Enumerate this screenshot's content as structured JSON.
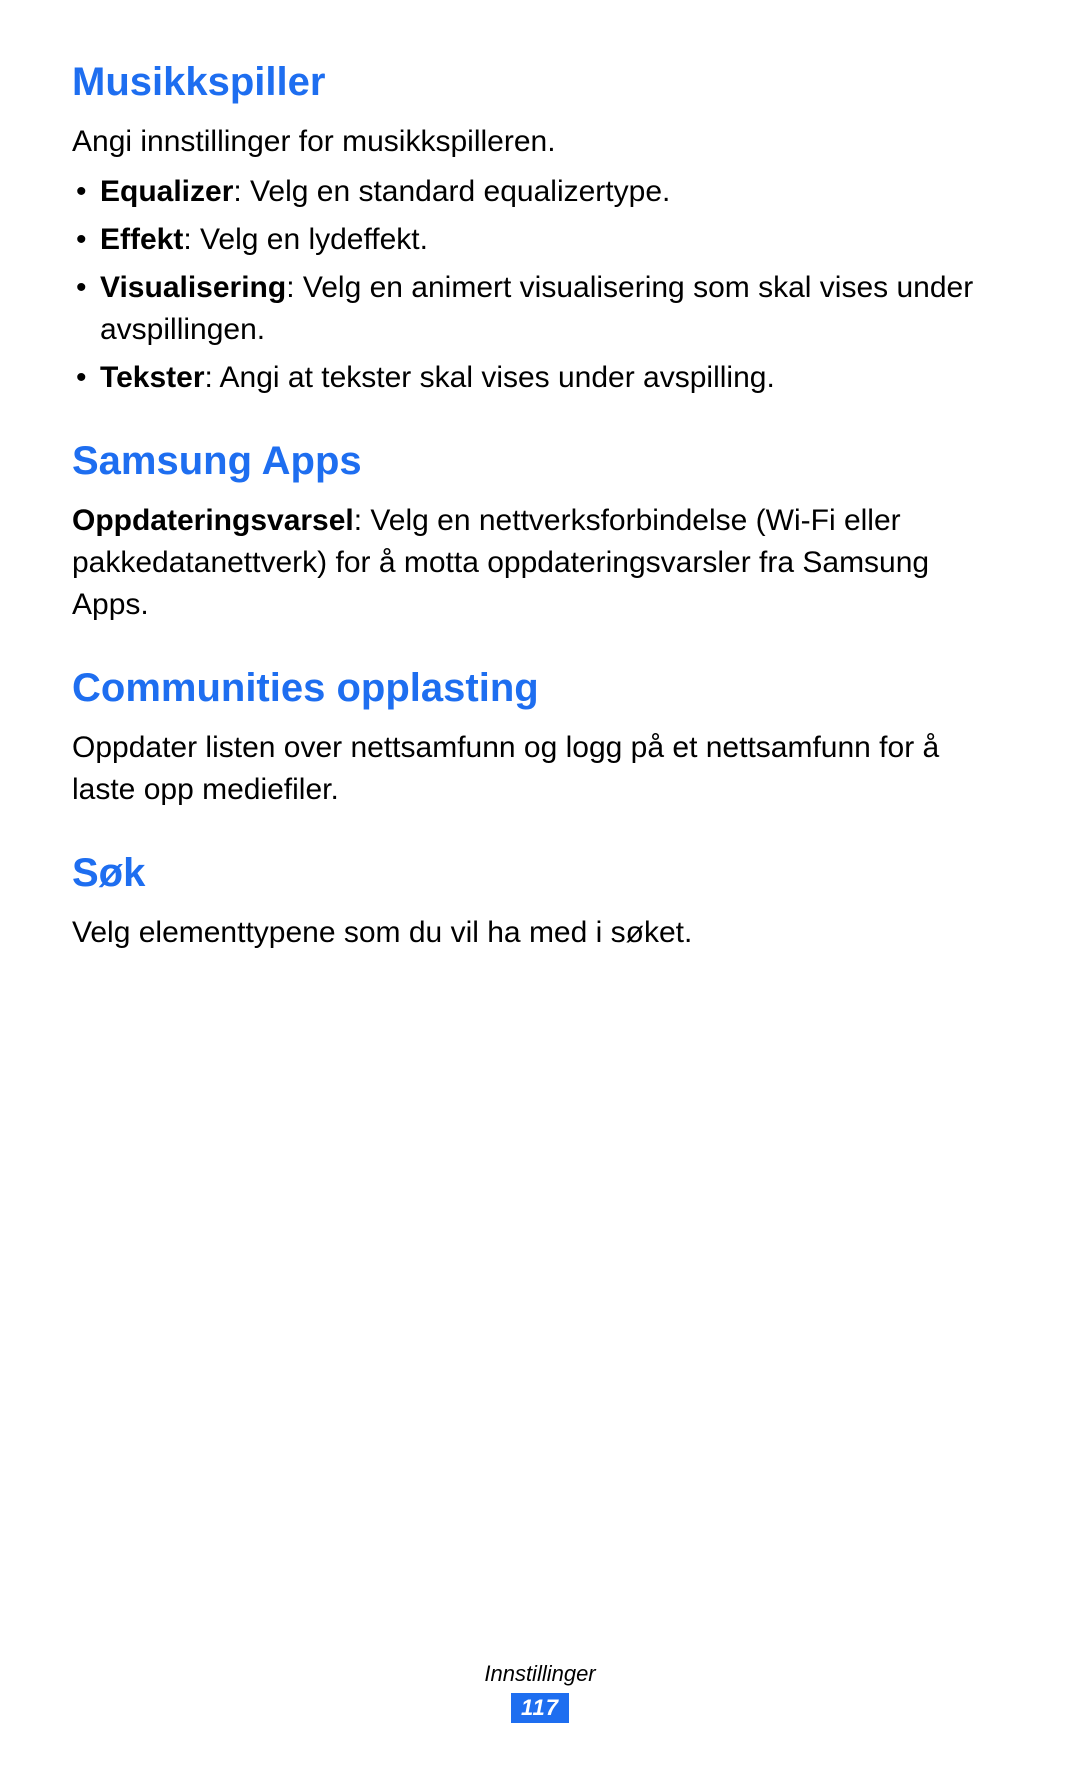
{
  "sections": {
    "musikkspiller": {
      "heading": "Musikkspiller",
      "intro": "Angi innstillinger for musikkspilleren.",
      "items": [
        {
          "bold": "Equalizer",
          "rest": ": Velg en standard equalizertype."
        },
        {
          "bold": "Effekt",
          "rest": ": Velg en lydeffekt."
        },
        {
          "bold": "Visualisering",
          "rest": ": Velg en animert visualisering som skal vises under avspillingen."
        },
        {
          "bold": "Tekster",
          "rest": ": Angi at tekster skal vises under avspilling."
        }
      ]
    },
    "samsungApps": {
      "heading": "Samsung Apps",
      "bodyBold": "Oppdateringsvarsel",
      "bodyRest": ": Velg en nettverksforbindelse (Wi-Fi eller pakkedatanettverk) for å motta oppdateringsvarsler fra Samsung Apps."
    },
    "communities": {
      "heading": "Communities opplasting",
      "body": "Oppdater listen over nettsamfunn og logg på et nettsamfunn for å laste opp mediefiler."
    },
    "sok": {
      "heading": "Søk",
      "body": "Velg elementtypene som du vil ha med i søket."
    }
  },
  "footer": {
    "label": "Innstillinger",
    "page": "117"
  }
}
